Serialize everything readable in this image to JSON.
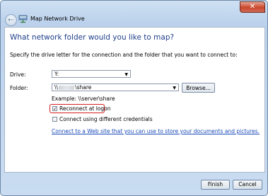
{
  "window": {
    "title": "Map Network Drive",
    "close_glyph": "✕",
    "back_glyph": "←"
  },
  "content": {
    "heading": "What network folder would you like to map?",
    "instructions": "Specify the drive letter for the connection and the folder that you want to connect to:",
    "drive_label": "Drive:",
    "drive_value": "Y:",
    "folder_label": "Folder:",
    "folder_value_prefix": "\\\\",
    "folder_value_suffix": "\\share",
    "browse_label": "Browse...",
    "example": "Example: \\\\server\\share",
    "reconnect_label": "Reconnect at logon",
    "reconnect_checked": true,
    "credentials_label": "Connect using different credentials",
    "credentials_checked": false,
    "web_link": "Connect to a Web site that you can use to store your documents and pictures."
  },
  "buttons": {
    "finish": "Finish",
    "cancel": "Cancel"
  },
  "icons": {
    "close": "close-icon",
    "back": "back-arrow-icon",
    "network": "network-drive-icon",
    "dropdown": "chevron-down-icon"
  },
  "colors": {
    "heading": "#1e3f8a",
    "link": "#1a49b8",
    "highlight": "#d62020",
    "close_button": "#c9462c"
  }
}
